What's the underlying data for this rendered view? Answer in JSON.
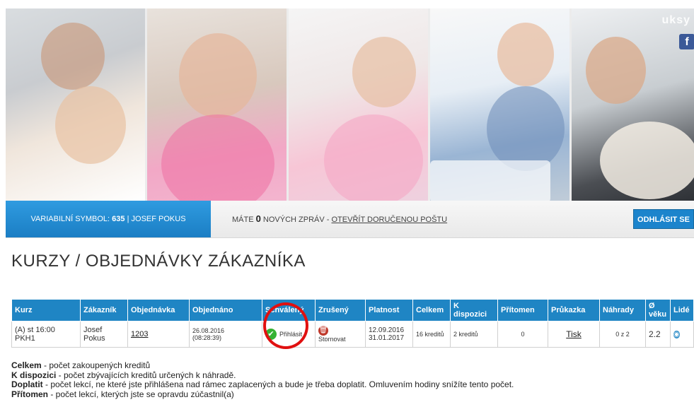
{
  "branding": {
    "name": "uksy",
    "facebook_icon": "f"
  },
  "header": {
    "variable_symbol_label": "VARIABILNÍ SYMBOL:",
    "variable_symbol_value": "635",
    "separator": "|",
    "user_name": "JOSEF POKUS",
    "messages_prefix": "MÁTE",
    "messages_count": "0",
    "messages_suffix": "NOVÝCH ZPRÁV -",
    "open_inbox_link": "OTEVŘÍT DORUČENOU POŠTU",
    "logout_button": "ODHLÁSIT SE"
  },
  "page_title": "KURZY / OBJEDNÁVKY ZÁKAZNÍKA",
  "table": {
    "headers": [
      "Kurz",
      "Zákazník",
      "Objednávka",
      "Objednáno",
      "Schválený",
      "Zrušený",
      "Platnost",
      "Celkem",
      "K dispozici",
      "Přítomen",
      "Průkazka",
      "Náhrady",
      "Ø věku",
      "Lidé"
    ],
    "row": {
      "course": "(A) st 16:00 PKH1",
      "customer": "Josef Pokus",
      "order_number": "1203",
      "ordered_date": "26.08.2016",
      "ordered_time": "(08:28:39)",
      "approve_label": "Přihlásit",
      "cancel_label": "Stornovat",
      "valid_from": "12.09.2016",
      "valid_to": "31.01.2017",
      "total": "16 kreditů",
      "available": "2 kreditů",
      "present": "0",
      "card": "Tisk",
      "replacements": "0 z 2",
      "avg_age": "2.2"
    }
  },
  "legend": [
    {
      "term": "Celkem",
      "text": " - počet zakoupených kreditů"
    },
    {
      "term": "K dispozici",
      "text": " - počet zbývajících kreditů určených k náhradě."
    },
    {
      "term": "Doplatit",
      "text": " - počet lekcí, ne které jste přihlášena nad rámec zaplacených a bude je třeba doplatit. Omluvením hodiny snížíte tento počet."
    },
    {
      "term": "Přítomen",
      "text": " - počet lekcí, kterých jste se opravdu zúčastnil(a)"
    }
  ],
  "colors": {
    "accent": "#1f85c4",
    "highlight_circle": "#e01010",
    "approved": "#35b233",
    "cancel": "#c0392b"
  }
}
